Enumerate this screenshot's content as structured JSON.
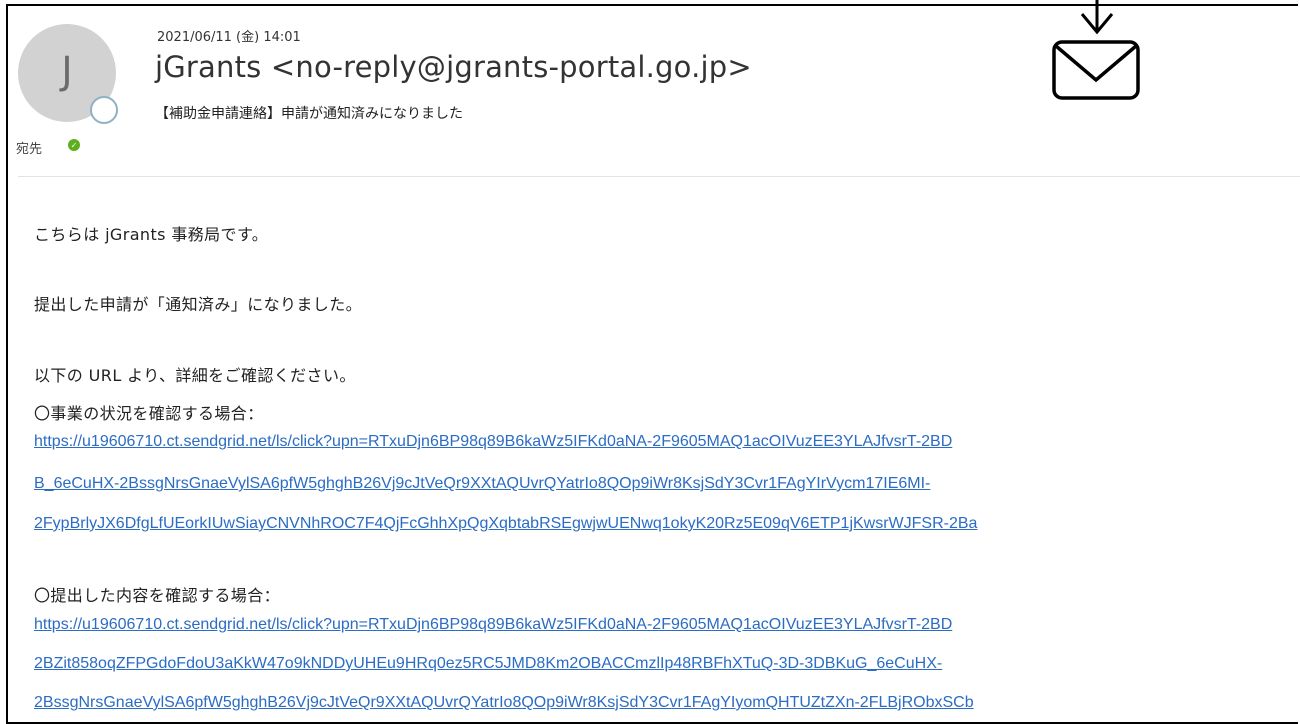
{
  "header": {
    "avatar_initial": "J",
    "timestamp": "2021/06/11 (金) 14:01",
    "sender": "jGrants <no-reply@jgrants-portal.go.jp>",
    "subject": "【補助金申請連絡】申請が通知済みになりました",
    "to_label": "宛先"
  },
  "icons": {
    "mail": "envelope-icon",
    "arrow": "arrow-down-icon",
    "presence": "presence-status-icon",
    "to_status": "check-circle-icon"
  },
  "body": {
    "greeting": "こちらは jGrants 事務局です。",
    "status_line": "提出した申請が「通知済み」になりました。",
    "url_intro": "以下の URL より、詳細をご確認ください。",
    "business_status_label": "〇事業の状況を確認する場合：",
    "business_link_lines": [
      "https://u19606710.ct.sendgrid.net/ls/click?upn=RTxuDjn6BP98q89B6kaWz5IFKd0aNA-2F9605MAQ1acOIVuzEE3YLAJfvsrT-2BD",
      "B_6eCuHX-2BssgNrsGnaeVylSA6pfW5ghghB26Vj9cJtVeQr9XXtAQUvrQYatrIo8QOp9iWr8KsjSdY3Cvr1FAgYIrVycm17IE6MI-",
      "2FypBrlyJX6DfgLfUEorkIUwSiayCNVNhROC7F4QjFcGhhXpQgXqbtabRSEgwjwUENwq1okyK20Rz5E09qV6ETP1jKwsrWJFSR-2Ba"
    ],
    "submitted_content_label": "〇提出した内容を確認する場合：",
    "content_link_lines": [
      "https://u19606710.ct.sendgrid.net/ls/click?upn=RTxuDjn6BP98q89B6kaWz5IFKd0aNA-2F9605MAQ1acOIVuzEE3YLAJfvsrT-2BD",
      "2BZit858oqZFPGdoFdoU3aKkW47o9kNDDyUHEu9HRq0ez5RC5JMD8Km2OBACCmzlIp48RBFhXTuQ-3D-3DBKuG_6eCuHX-",
      "2BssgNrsGnaeVylSA6pfW5ghghB26Vj9cJtVeQr9XXtAQUvrQYatrIo8QOp9iWr8KsjSdY3Cvr1FAgYIyomQHTUZtZXn-2FLBjRObxSCb"
    ]
  },
  "colors": {
    "link": "#2b6cc4",
    "avatar_bg": "#d2d2d2",
    "status_green": "#5fae1e"
  }
}
